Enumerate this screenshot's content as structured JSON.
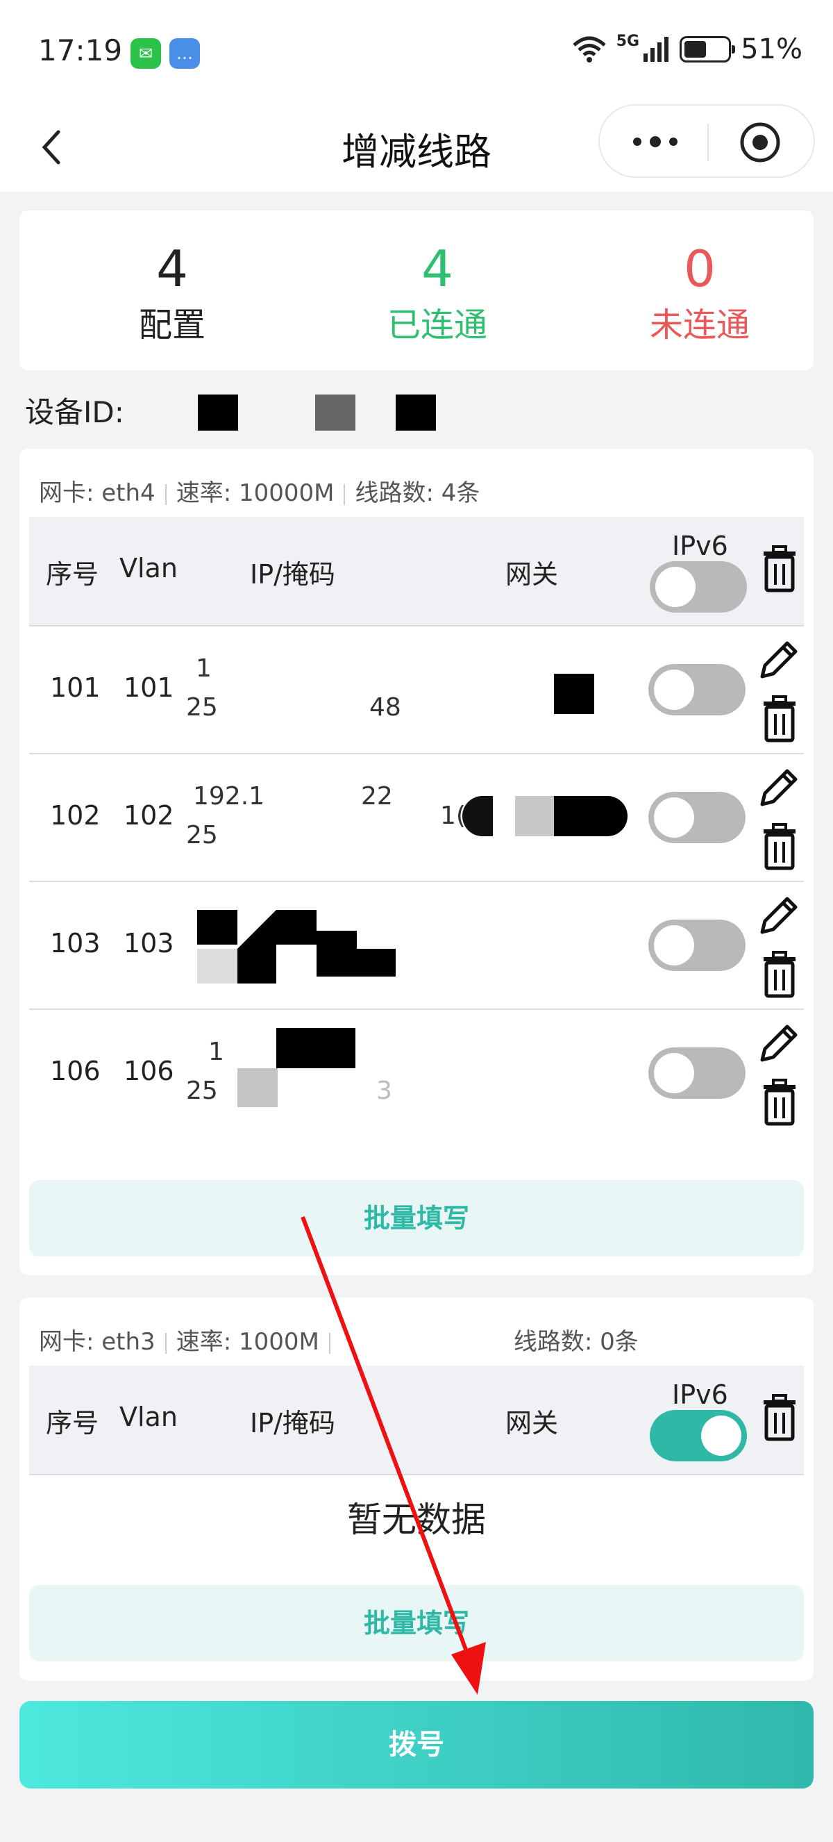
{
  "status_bar": {
    "time": "17:19",
    "network": "5G",
    "battery_text": "51%",
    "battery_level": 0.51
  },
  "nav": {
    "title": "增减线路",
    "back_icon": "chevron-left-icon",
    "more_icon": "more-dots-icon",
    "close_icon": "target-circle-icon"
  },
  "stats": [
    {
      "value": "4",
      "label": "配置",
      "color": "#222222"
    },
    {
      "value": "4",
      "label": "已连通",
      "color": "#2fbf71"
    },
    {
      "value": "0",
      "label": "未连通",
      "color": "#e9585a"
    }
  ],
  "device": {
    "label": "设备ID:"
  },
  "ports": [
    {
      "nic": "网卡: eth4",
      "rate": "速率: 10000M",
      "lines": "线路数: 4条",
      "headers": {
        "seq": "序号",
        "vlan": "Vlan",
        "ip": "IP/掩码",
        "gateway": "网关",
        "ipv6": "IPv6"
      },
      "ipv6_master_on": false,
      "rows": [
        {
          "seq": "101",
          "vlan": "101",
          "ip1": "1",
          "ip2": "25",
          "ip2b": "48",
          "gw": "",
          "ipv6_on": false
        },
        {
          "seq": "102",
          "vlan": "102",
          "ip1": "192.1",
          "ip1b": "22",
          "ip2": "25",
          "gw": "1(",
          "ipv6_on": false
        },
        {
          "seq": "103",
          "vlan": "103",
          "ip1": "",
          "ip2": "",
          "gw": "",
          "ipv6_on": false
        },
        {
          "seq": "106",
          "vlan": "106",
          "ip1": "1",
          "ip2": "25",
          "ip2b": "3",
          "gw": "",
          "ipv6_on": false
        }
      ],
      "batch_label": "批量填写"
    },
    {
      "nic": "网卡: eth3",
      "rate": "速率: 1000M",
      "lines": "线路数: 0条",
      "headers": {
        "seq": "序号",
        "vlan": "Vlan",
        "ip": "IP/掩码",
        "gateway": "网关",
        "ipv6": "IPv6"
      },
      "ipv6_master_on": true,
      "rows": [],
      "empty_text": "暂无数据",
      "batch_label": "批量填写"
    }
  ],
  "dial_button": "拨号",
  "colors": {
    "accent": "#2fb8a6",
    "success": "#2fbf71",
    "danger": "#e9585a",
    "arrow": "#ee1111"
  }
}
